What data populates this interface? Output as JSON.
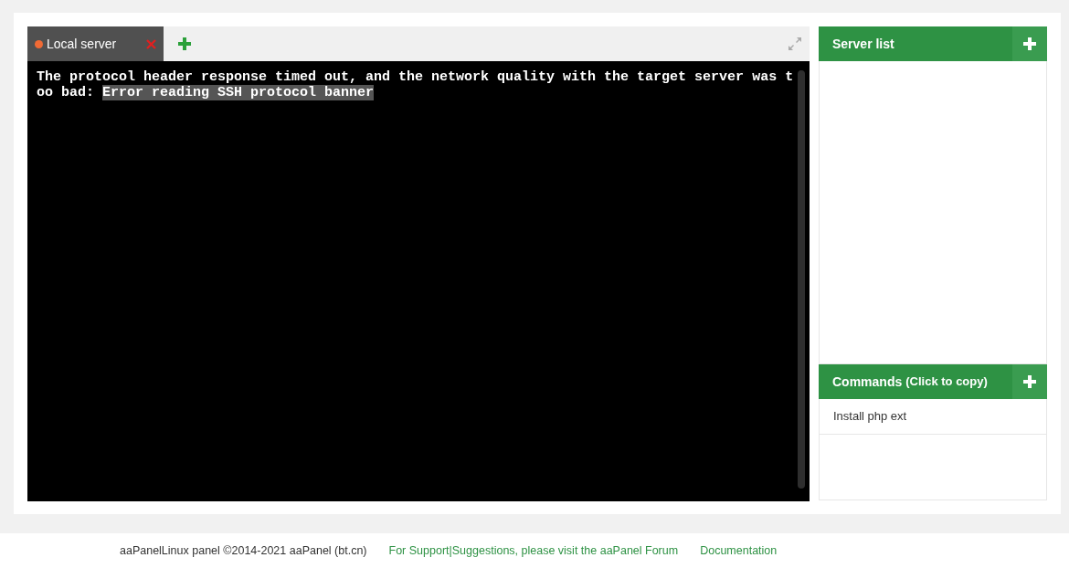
{
  "terminal": {
    "tabs": [
      {
        "label": "Local server",
        "color": "#f06a35",
        "selected": true
      }
    ],
    "lines": [
      [
        {
          "text": "The protocol header response timed out, and the network quality with the target server was t",
          "highlighted": false
        }
      ],
      [
        {
          "text": "oo bad: ",
          "highlighted": false
        },
        {
          "text": "Error reading SSH protocol banner",
          "highlighted": true
        }
      ]
    ]
  },
  "server_list": {
    "title": "Server list"
  },
  "commands": {
    "title": "Commands",
    "hint": "(Click to copy)",
    "items": [
      "Install php ext"
    ]
  },
  "footer": {
    "copyright": "aaPanelLinux panel ©2014-2021 aaPanel (bt.cn)",
    "links": [
      "For Support|Suggestions, please visit the aaPanel Forum",
      "Documentation"
    ]
  }
}
